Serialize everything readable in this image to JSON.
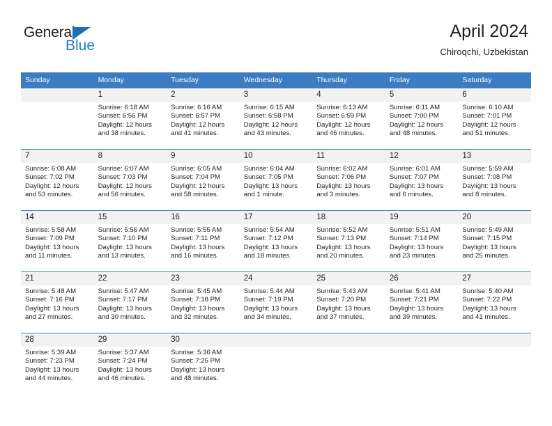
{
  "brand": {
    "name_top": "General",
    "name_bottom": "Blue",
    "triangle_color": "#1f6fb5",
    "blue_color": "#1f7ac4"
  },
  "header": {
    "title": "April 2024",
    "subtitle": "Chiroqchi, Uzbekistan"
  },
  "theme": {
    "header_bg": "#3b7dc0",
    "header_text": "#ffffff",
    "daynum_bg": "#f2f2f2",
    "text": "#231f20",
    "row_border": "#3b7dc0"
  },
  "weekday_headers": [
    "Sunday",
    "Monday",
    "Tuesday",
    "Wednesday",
    "Thursday",
    "Friday",
    "Saturday"
  ],
  "weeks": [
    [
      {
        "day": "",
        "sunrise": "",
        "sunset": "",
        "daylight_line1": "",
        "daylight_line2": ""
      },
      {
        "day": "1",
        "sunrise": "Sunrise: 6:18 AM",
        "sunset": "Sunset: 6:56 PM",
        "daylight_line1": "Daylight: 12 hours",
        "daylight_line2": "and 38 minutes."
      },
      {
        "day": "2",
        "sunrise": "Sunrise: 6:16 AM",
        "sunset": "Sunset: 6:57 PM",
        "daylight_line1": "Daylight: 12 hours",
        "daylight_line2": "and 41 minutes."
      },
      {
        "day": "3",
        "sunrise": "Sunrise: 6:15 AM",
        "sunset": "Sunset: 6:58 PM",
        "daylight_line1": "Daylight: 12 hours",
        "daylight_line2": "and 43 minutes."
      },
      {
        "day": "4",
        "sunrise": "Sunrise: 6:13 AM",
        "sunset": "Sunset: 6:59 PM",
        "daylight_line1": "Daylight: 12 hours",
        "daylight_line2": "and 46 minutes."
      },
      {
        "day": "5",
        "sunrise": "Sunrise: 6:11 AM",
        "sunset": "Sunset: 7:00 PM",
        "daylight_line1": "Daylight: 12 hours",
        "daylight_line2": "and 48 minutes."
      },
      {
        "day": "6",
        "sunrise": "Sunrise: 6:10 AM",
        "sunset": "Sunset: 7:01 PM",
        "daylight_line1": "Daylight: 12 hours",
        "daylight_line2": "and 51 minutes."
      }
    ],
    [
      {
        "day": "7",
        "sunrise": "Sunrise: 6:08 AM",
        "sunset": "Sunset: 7:02 PM",
        "daylight_line1": "Daylight: 12 hours",
        "daylight_line2": "and 53 minutes."
      },
      {
        "day": "8",
        "sunrise": "Sunrise: 6:07 AM",
        "sunset": "Sunset: 7:03 PM",
        "daylight_line1": "Daylight: 12 hours",
        "daylight_line2": "and 56 minutes."
      },
      {
        "day": "9",
        "sunrise": "Sunrise: 6:05 AM",
        "sunset": "Sunset: 7:04 PM",
        "daylight_line1": "Daylight: 12 hours",
        "daylight_line2": "and 58 minutes."
      },
      {
        "day": "10",
        "sunrise": "Sunrise: 6:04 AM",
        "sunset": "Sunset: 7:05 PM",
        "daylight_line1": "Daylight: 13 hours",
        "daylight_line2": "and 1 minute."
      },
      {
        "day": "11",
        "sunrise": "Sunrise: 6:02 AM",
        "sunset": "Sunset: 7:06 PM",
        "daylight_line1": "Daylight: 13 hours",
        "daylight_line2": "and 3 minutes."
      },
      {
        "day": "12",
        "sunrise": "Sunrise: 6:01 AM",
        "sunset": "Sunset: 7:07 PM",
        "daylight_line1": "Daylight: 13 hours",
        "daylight_line2": "and 6 minutes."
      },
      {
        "day": "13",
        "sunrise": "Sunrise: 5:59 AM",
        "sunset": "Sunset: 7:08 PM",
        "daylight_line1": "Daylight: 13 hours",
        "daylight_line2": "and 8 minutes."
      }
    ],
    [
      {
        "day": "14",
        "sunrise": "Sunrise: 5:58 AM",
        "sunset": "Sunset: 7:09 PM",
        "daylight_line1": "Daylight: 13 hours",
        "daylight_line2": "and 11 minutes."
      },
      {
        "day": "15",
        "sunrise": "Sunrise: 5:56 AM",
        "sunset": "Sunset: 7:10 PM",
        "daylight_line1": "Daylight: 13 hours",
        "daylight_line2": "and 13 minutes."
      },
      {
        "day": "16",
        "sunrise": "Sunrise: 5:55 AM",
        "sunset": "Sunset: 7:11 PM",
        "daylight_line1": "Daylight: 13 hours",
        "daylight_line2": "and 16 minutes."
      },
      {
        "day": "17",
        "sunrise": "Sunrise: 5:54 AM",
        "sunset": "Sunset: 7:12 PM",
        "daylight_line1": "Daylight: 13 hours",
        "daylight_line2": "and 18 minutes."
      },
      {
        "day": "18",
        "sunrise": "Sunrise: 5:52 AM",
        "sunset": "Sunset: 7:13 PM",
        "daylight_line1": "Daylight: 13 hours",
        "daylight_line2": "and 20 minutes."
      },
      {
        "day": "19",
        "sunrise": "Sunrise: 5:51 AM",
        "sunset": "Sunset: 7:14 PM",
        "daylight_line1": "Daylight: 13 hours",
        "daylight_line2": "and 23 minutes."
      },
      {
        "day": "20",
        "sunrise": "Sunrise: 5:49 AM",
        "sunset": "Sunset: 7:15 PM",
        "daylight_line1": "Daylight: 13 hours",
        "daylight_line2": "and 25 minutes."
      }
    ],
    [
      {
        "day": "21",
        "sunrise": "Sunrise: 5:48 AM",
        "sunset": "Sunset: 7:16 PM",
        "daylight_line1": "Daylight: 13 hours",
        "daylight_line2": "and 27 minutes."
      },
      {
        "day": "22",
        "sunrise": "Sunrise: 5:47 AM",
        "sunset": "Sunset: 7:17 PM",
        "daylight_line1": "Daylight: 13 hours",
        "daylight_line2": "and 30 minutes."
      },
      {
        "day": "23",
        "sunrise": "Sunrise: 5:45 AM",
        "sunset": "Sunset: 7:18 PM",
        "daylight_line1": "Daylight: 13 hours",
        "daylight_line2": "and 32 minutes."
      },
      {
        "day": "24",
        "sunrise": "Sunrise: 5:44 AM",
        "sunset": "Sunset: 7:19 PM",
        "daylight_line1": "Daylight: 13 hours",
        "daylight_line2": "and 34 minutes."
      },
      {
        "day": "25",
        "sunrise": "Sunrise: 5:43 AM",
        "sunset": "Sunset: 7:20 PM",
        "daylight_line1": "Daylight: 13 hours",
        "daylight_line2": "and 37 minutes."
      },
      {
        "day": "26",
        "sunrise": "Sunrise: 5:41 AM",
        "sunset": "Sunset: 7:21 PM",
        "daylight_line1": "Daylight: 13 hours",
        "daylight_line2": "and 39 minutes."
      },
      {
        "day": "27",
        "sunrise": "Sunrise: 5:40 AM",
        "sunset": "Sunset: 7:22 PM",
        "daylight_line1": "Daylight: 13 hours",
        "daylight_line2": "and 41 minutes."
      }
    ],
    [
      {
        "day": "28",
        "sunrise": "Sunrise: 5:39 AM",
        "sunset": "Sunset: 7:23 PM",
        "daylight_line1": "Daylight: 13 hours",
        "daylight_line2": "and 44 minutes."
      },
      {
        "day": "29",
        "sunrise": "Sunrise: 5:37 AM",
        "sunset": "Sunset: 7:24 PM",
        "daylight_line1": "Daylight: 13 hours",
        "daylight_line2": "and 46 minutes."
      },
      {
        "day": "30",
        "sunrise": "Sunrise: 5:36 AM",
        "sunset": "Sunset: 7:25 PM",
        "daylight_line1": "Daylight: 13 hours",
        "daylight_line2": "and 48 minutes."
      },
      {
        "day": "",
        "sunrise": "",
        "sunset": "",
        "daylight_line1": "",
        "daylight_line2": ""
      },
      {
        "day": "",
        "sunrise": "",
        "sunset": "",
        "daylight_line1": "",
        "daylight_line2": ""
      },
      {
        "day": "",
        "sunrise": "",
        "sunset": "",
        "daylight_line1": "",
        "daylight_line2": ""
      },
      {
        "day": "",
        "sunrise": "",
        "sunset": "",
        "daylight_line1": "",
        "daylight_line2": ""
      }
    ]
  ]
}
